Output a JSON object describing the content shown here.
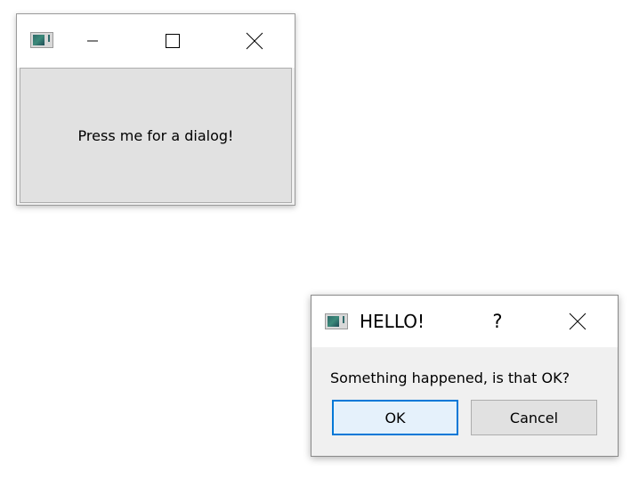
{
  "main_window": {
    "button_label": "Press me for a dialog!",
    "icons": {
      "app": "app-icon",
      "minimize": "minimize-icon",
      "maximize": "maximize-icon",
      "close": "close-icon"
    }
  },
  "dialog": {
    "title": "HELLO!",
    "help_label": "?",
    "message": "Something happened, is that OK?",
    "ok_label": "OK",
    "cancel_label": "Cancel",
    "icons": {
      "app": "app-icon",
      "close": "close-icon"
    }
  },
  "colors": {
    "focus_border": "#0078d7",
    "button_face": "#e1e1e1",
    "window_bg": "#f0f0f0",
    "titlebar_bg": "#ffffff"
  }
}
